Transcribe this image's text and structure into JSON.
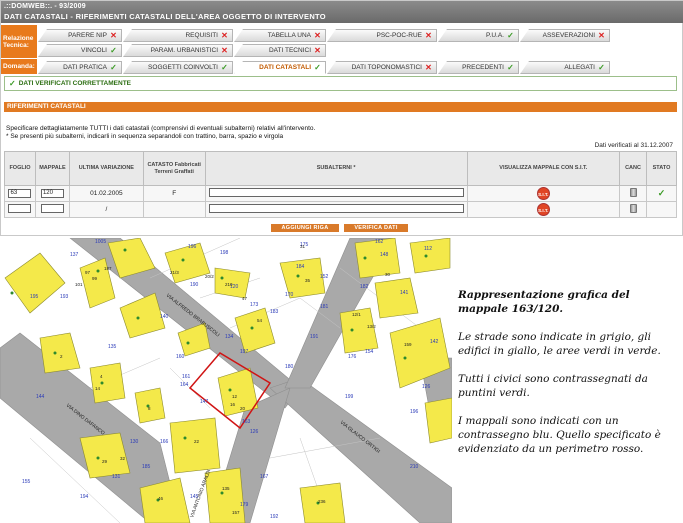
{
  "header": {
    "app": ".::DOMWEB::. - 93/2009",
    "title": "DATI CATASTALI - RIFERIMENTI CATASTALI DELL'AREA OGGETTO DI INTERVENTO"
  },
  "tabs": {
    "row1_label": "Relazione Tecnica:",
    "row2_label": "Domanda:",
    "row1": [
      {
        "label": "PARERE NIP",
        "status": "x"
      },
      {
        "label": "REQUISITI",
        "status": "x"
      },
      {
        "label": "TABELLA UNA",
        "status": "x"
      },
      {
        "label": "PSC-POC-RUE",
        "status": "x"
      },
      {
        "label": "P.U.A.",
        "status": "ok"
      },
      {
        "label": "ASSEVERAZIONI",
        "status": "x"
      }
    ],
    "row1b": [
      {
        "label": "VINCOLI",
        "status": "ok"
      },
      {
        "label": "PARAM. URBANISTICI",
        "status": "x"
      },
      {
        "label": "DATI TECNICI",
        "status": "x"
      }
    ],
    "row2": [
      {
        "label": "DATI PRATICA",
        "status": "ok"
      },
      {
        "label": "SOGGETTI COINVOLTI",
        "status": "ok"
      },
      {
        "label": "DATI CATASTALI",
        "status": "ok"
      },
      {
        "label": "DATI TOPONOMASTICI",
        "status": "x"
      },
      {
        "label": "PRECEDENTI",
        "status": "ok"
      },
      {
        "label": "ALLEGATI",
        "status": "ok"
      }
    ]
  },
  "verified_msg": "DATI VERIFICATI CORRETTAMENTE",
  "section_title": "RIFERIMENTI CATASTALI",
  "instructions": [
    "Specificare dettagliatamente TUTTI i dati catastali (comprensivi di eventuali subalterni) relativi all'intervento.",
    "* Se presenti più subalterni, indicarli in sequenza separandoli con trattino, barra, spazio e virgola"
  ],
  "verified_date": "Dati verificati al 31.12.2007",
  "table": {
    "headers": [
      "FOGLIO",
      "MAPPALE",
      "ULTIMA VARIAZIONE",
      "CATASTO Fabbricati Terreni Graffati",
      "SUBALTERNI *",
      "VISUALIZZA MAPPALE CON S.I.T.",
      "CANC",
      "STATO"
    ],
    "rows": [
      {
        "foglio": "63",
        "mappale": "120",
        "variazione": "01.02.2005",
        "catasto": "F",
        "subalterni": "",
        "stato": "✓"
      },
      {
        "foglio": "",
        "mappale": "",
        "variazione": "/",
        "catasto": "",
        "subalterni": "",
        "stato": ""
      }
    ],
    "sit_label": "S.I.T."
  },
  "buttons": {
    "add_row": "AGGIUNGI RIGA",
    "verify": "VERIFICA DATI"
  },
  "map": {
    "streets": [
      "VIA ALFREDO BRABUSCOLI",
      "VIA DINO DAFANCO",
      "VIA GLAUCO ORTIGI",
      "VIA ANTONIO ARALDI"
    ],
    "parcel_numbers": [
      "195",
      "137",
      "1005",
      "196",
      "190",
      "198",
      "120",
      "173",
      "170",
      "175",
      "184",
      "162",
      "112",
      "152",
      "182",
      "148",
      "141",
      "176",
      "126",
      "147",
      "145",
      "179",
      "167",
      "166",
      "164",
      "199",
      "197",
      "134",
      "135",
      "130",
      "185",
      "131",
      "140",
      "160",
      "161",
      "163",
      "154",
      "196",
      "126",
      "142",
      "191",
      "181",
      "183",
      "180",
      "144",
      "155",
      "192",
      "193",
      "194",
      "210"
    ],
    "civic_numbers": [
      "97",
      "99",
      "101",
      "187",
      "21/3",
      "20/2",
      "210",
      "47",
      "54",
      "31",
      "35",
      "30",
      "12/1",
      "13/2",
      "159",
      "2",
      "4",
      "14",
      "8",
      "12",
      "16",
      "20",
      "22",
      "29",
      "32",
      "46",
      "135",
      "157",
      "236"
    ]
  },
  "caption": {
    "title": "Rappresentazione grafica del mappale 163/120.",
    "p1": "Le strade sono indicate in grigio, gli edifici in giallo, le aree verdi in verde.",
    "p2": "Tutti i civici sono contrassegnati da puntini verdi.",
    "p3": "I mappali sono indicati con un contrassegno blu. Quello specificato è evidenziato da un perimetro rosso."
  },
  "colors": {
    "accent": "#e87a1c",
    "street": "#a9a9a9",
    "building": "#f4e94a",
    "parcel_number": "#2a3ab8",
    "civic_dot": "#2d8a2d",
    "selection": "#d01414"
  }
}
